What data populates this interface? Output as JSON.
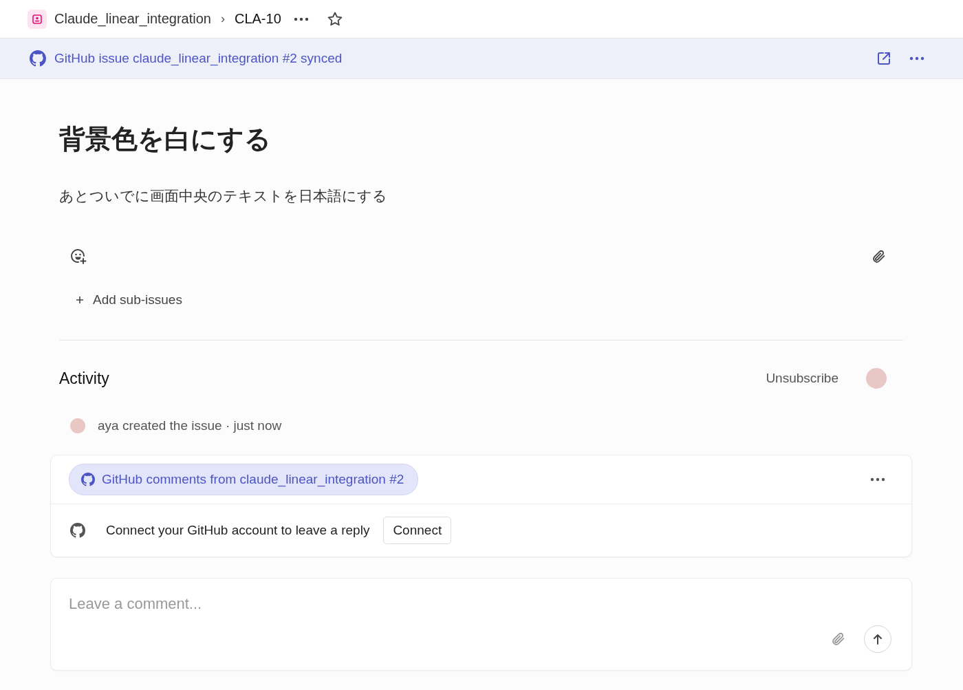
{
  "breadcrumb": {
    "project": "Claude_linear_integration",
    "separator": "›",
    "issue": "CLA-10"
  },
  "banner": {
    "text": "GitHub issue claude_linear_integration #2 synced"
  },
  "issue": {
    "title": "背景色を白にする",
    "description": "あとついでに画面中央のテキストを日本語にする"
  },
  "sub_issues": {
    "label": "Add sub-issues"
  },
  "activity": {
    "heading": "Activity",
    "unsubscribe": "Unsubscribe",
    "events": [
      {
        "text": "aya created the issue · just now"
      }
    ]
  },
  "thread": {
    "source": "GitHub comments from claude_linear_integration #2",
    "prompt": "Connect your GitHub account to leave a reply",
    "button": "Connect"
  },
  "composer": {
    "placeholder": "Leave a comment..."
  }
}
